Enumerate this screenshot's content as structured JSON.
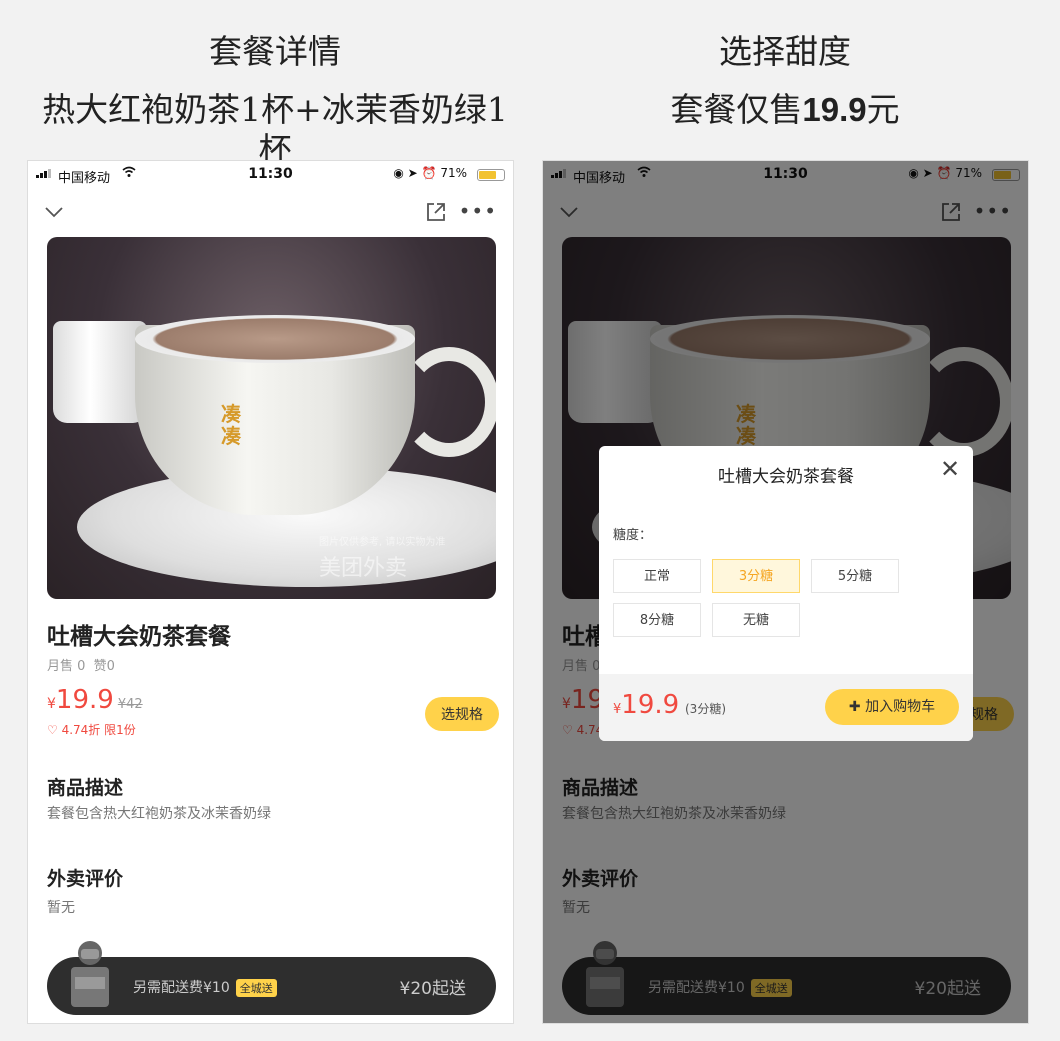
{
  "captions": {
    "left": {
      "line1": "套餐详情",
      "line2": "热大红袍奶茶1杯+冰茉香奶绿1杯"
    },
    "right": {
      "line1": "选择甜度",
      "line2_prefix": "套餐仅售",
      "line2_price": "19.9",
      "line2_suffix": "元"
    }
  },
  "status_bar": {
    "carrier": "中国移动",
    "time": "11:30",
    "battery": "71%",
    "battery_level": 0.71
  },
  "product": {
    "name": "吐槽大会奶茶套餐",
    "monthly_sales": "月售 0",
    "likes": "赞0",
    "currency": "¥",
    "price": "19.9",
    "original_price": "¥42",
    "promo": "♡ 4.74折 限1份",
    "spec_button": "选规格"
  },
  "image_watermark": {
    "note": "图片仅供参考, 请以实物为准",
    "brand": "美团外卖",
    "logo_text": "凑凑"
  },
  "description": {
    "title": "商品描述",
    "text": "套餐包含热大红袍奶茶及冰茉香奶绿"
  },
  "reviews": {
    "title": "外卖评价",
    "text": "暂无"
  },
  "cart_bar": {
    "delivery_fee": "另需配送费¥10",
    "tag": "全城送",
    "minimum": "¥20起送"
  },
  "modal": {
    "title": "吐槽大会奶茶套餐",
    "label": "糖度：",
    "options": [
      "正常",
      "3分糖",
      "5分糖",
      "8分糖",
      "无糖"
    ],
    "selected_index": 1,
    "currency": "¥",
    "price": "19.9",
    "selected_text": "(3分糖)",
    "add_button": "加入购物车",
    "add_icon": "plus-icon",
    "close_icon": "close-icon"
  },
  "colors": {
    "accent": "#ffd24a",
    "price": "#f0493f",
    "cart_bar": "#2e2e2e",
    "selected_option": "#f5a623"
  }
}
